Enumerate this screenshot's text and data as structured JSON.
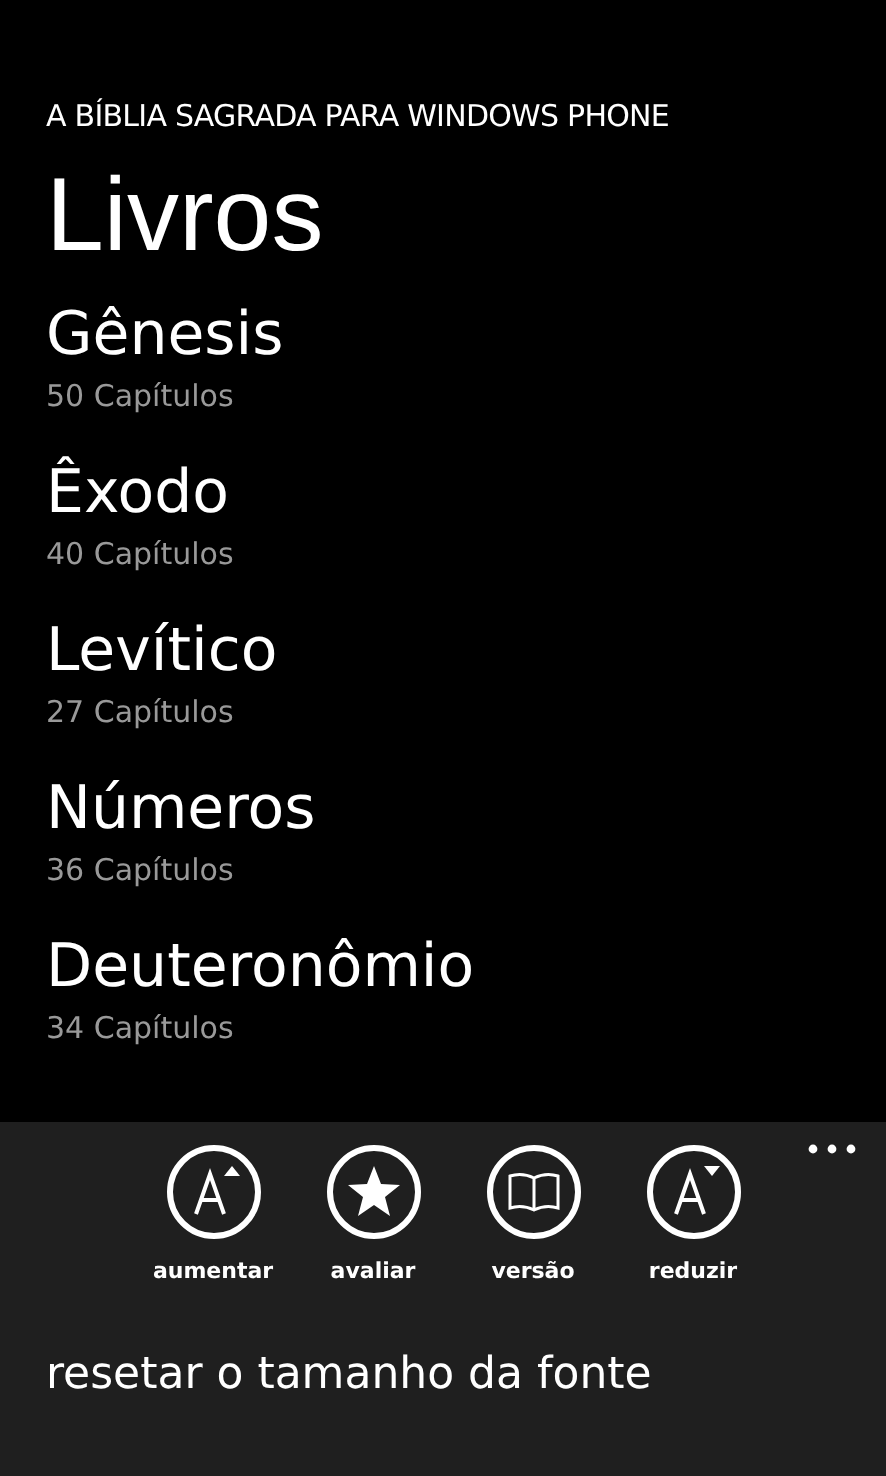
{
  "app_title": "A BÍBLIA SAGRADA PARA WINDOWS PHONE",
  "page_title": "Livros",
  "books": [
    {
      "name": "Gênesis",
      "chapters": "50 Capítulos"
    },
    {
      "name": "Êxodo",
      "chapters": "40 Capítulos"
    },
    {
      "name": "Levítico",
      "chapters": "27 Capítulos"
    },
    {
      "name": "Números",
      "chapters": "36 Capítulos"
    },
    {
      "name": "Deuteronômio",
      "chapters": "34 Capítulos"
    }
  ],
  "app_bar": {
    "buttons": [
      {
        "kind": "font-up",
        "label": "aumentar"
      },
      {
        "kind": "star",
        "label": "avaliar"
      },
      {
        "kind": "book",
        "label": "versão"
      },
      {
        "kind": "font-down",
        "label": "reduzir"
      }
    ],
    "menu_items": [
      "resetar o tamanho da fonte"
    ]
  }
}
